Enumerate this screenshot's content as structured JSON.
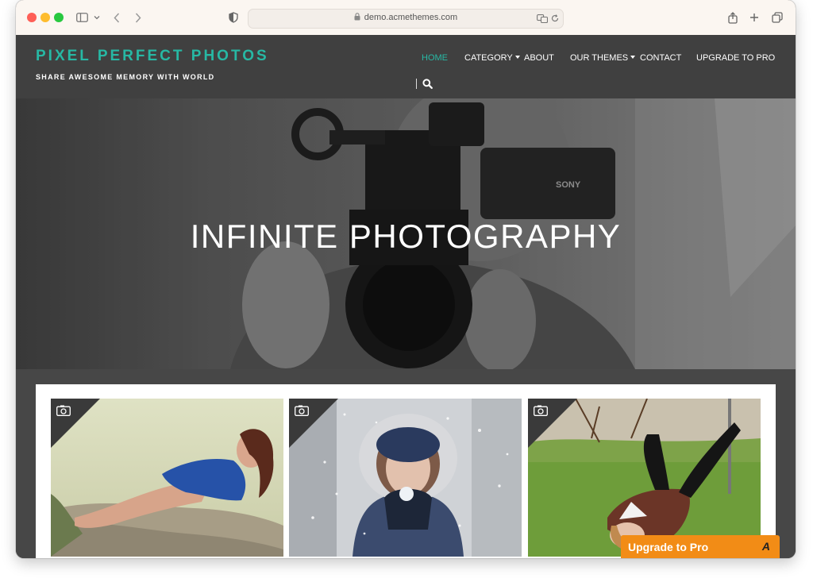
{
  "browser": {
    "url": "demo.acmethemes.com"
  },
  "site": {
    "title": "PIXEL PERFECT PHOTOS",
    "tagline": "SHARE AWESOME MEMORY WITH WORLD",
    "accent_color": "#27b8a4"
  },
  "nav": {
    "items": [
      {
        "label": "HOME",
        "active": true
      },
      {
        "label": "CATEGORY",
        "dropdown": true
      },
      {
        "label": "ABOUT"
      },
      {
        "label": "OUR THEMES",
        "dropdown": true
      },
      {
        "label": "CONTACT"
      },
      {
        "label": "UPGRADE TO PRO"
      }
    ]
  },
  "hero": {
    "title": "INFINITE PHOTOGRAPHY"
  },
  "gallery": {
    "items": [
      {
        "icon": "camera-icon",
        "subject": "woman in blue dress on rocks"
      },
      {
        "icon": "camera-icon",
        "subject": "woman in winter hood blowing snow"
      },
      {
        "icon": "camera-icon",
        "subject": "woman lying on grass"
      }
    ]
  },
  "upgrade_banner": {
    "label": "Upgrade to Pro",
    "color": "#f28c16"
  }
}
